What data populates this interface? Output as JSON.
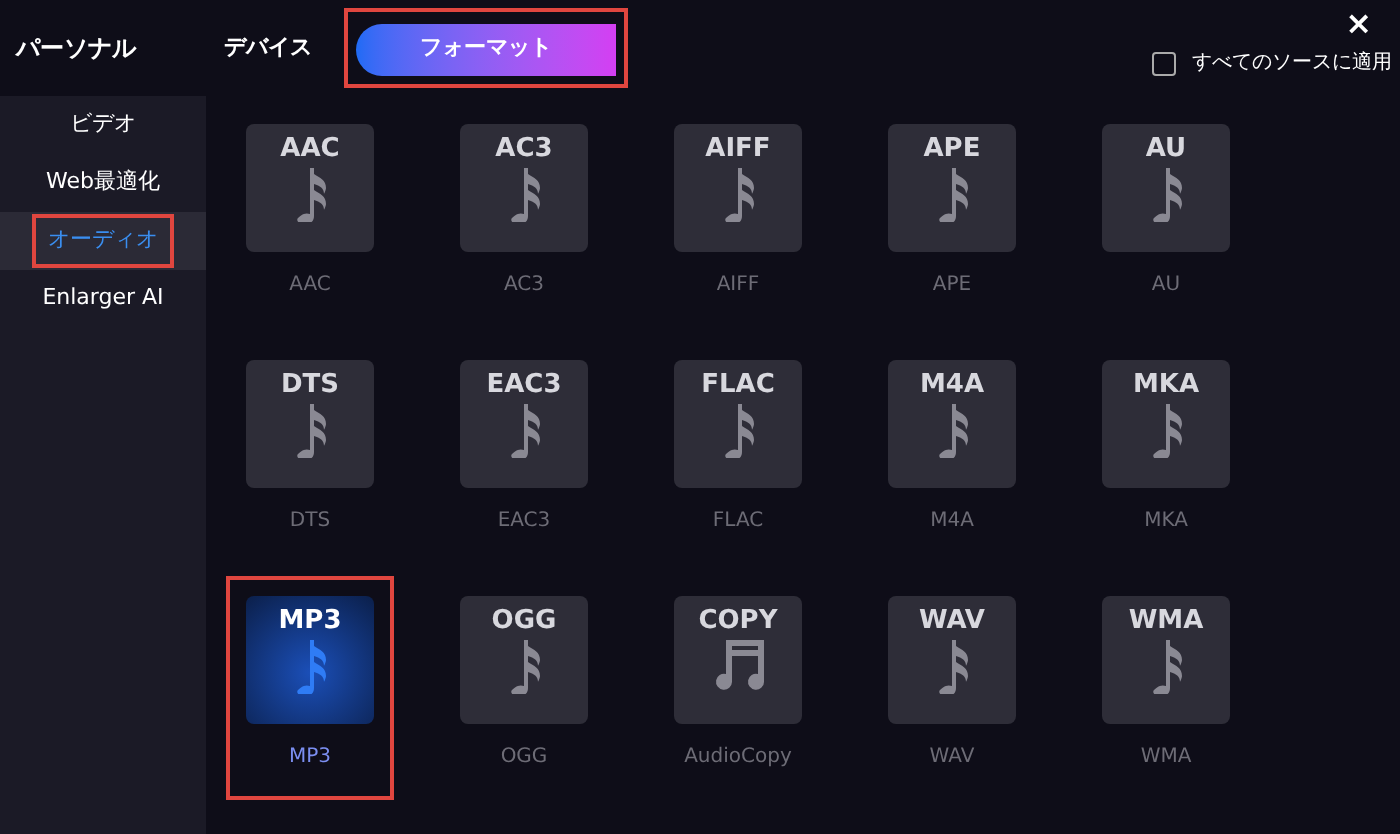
{
  "header": {
    "title": "パーソナル",
    "tabs": [
      {
        "label": "デバイス",
        "selected": false,
        "outlined": false
      },
      {
        "label": "フォーマット",
        "selected": true,
        "outlined": true
      }
    ],
    "close": "×",
    "apply_all": {
      "label": "すべてのソースに適用",
      "checked": false
    }
  },
  "sidebar": {
    "items": [
      {
        "label": "ビデオ",
        "selected": false,
        "outlined": false
      },
      {
        "label": "Web最適化",
        "selected": false,
        "outlined": false
      },
      {
        "label": "オーディオ",
        "selected": true,
        "outlined": true
      },
      {
        "label": "Enlarger AI",
        "selected": false,
        "outlined": false
      }
    ]
  },
  "formats": [
    {
      "badge": "AAC",
      "label": "AAC",
      "kind": "note",
      "selected": false,
      "outlined": false
    },
    {
      "badge": "AC3",
      "label": "AC3",
      "kind": "note",
      "selected": false,
      "outlined": false
    },
    {
      "badge": "AIFF",
      "label": "AIFF",
      "kind": "note",
      "selected": false,
      "outlined": false
    },
    {
      "badge": "APE",
      "label": "APE",
      "kind": "note",
      "selected": false,
      "outlined": false
    },
    {
      "badge": "AU",
      "label": "AU",
      "kind": "note",
      "selected": false,
      "outlined": false
    },
    {
      "badge": "DTS",
      "label": "DTS",
      "kind": "note",
      "selected": false,
      "outlined": false
    },
    {
      "badge": "EAC3",
      "label": "EAC3",
      "kind": "note",
      "selected": false,
      "outlined": false
    },
    {
      "badge": "FLAC",
      "label": "FLAC",
      "kind": "note",
      "selected": false,
      "outlined": false
    },
    {
      "badge": "M4A",
      "label": "M4A",
      "kind": "note",
      "selected": false,
      "outlined": false
    },
    {
      "badge": "MKA",
      "label": "MKA",
      "kind": "note",
      "selected": false,
      "outlined": false
    },
    {
      "badge": "MP3",
      "label": "MP3",
      "kind": "note",
      "selected": true,
      "outlined": true
    },
    {
      "badge": "OGG",
      "label": "OGG",
      "kind": "note",
      "selected": false,
      "outlined": false
    },
    {
      "badge": "COPY",
      "label": "AudioCopy",
      "kind": "double-note",
      "selected": false,
      "outlined": false
    },
    {
      "badge": "WAV",
      "label": "WAV",
      "kind": "note",
      "selected": false,
      "outlined": false
    },
    {
      "badge": "WMA",
      "label": "WMA",
      "kind": "note",
      "selected": false,
      "outlined": false
    }
  ]
}
